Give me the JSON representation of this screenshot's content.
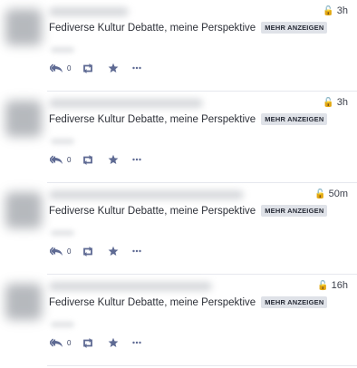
{
  "more_label": "MEHR ANZEIGEN",
  "statuses": [
    {
      "text": "Fediverse Kultur Debatte, meine Perspektive",
      "time": "3h",
      "reply_count": "0"
    },
    {
      "text": "Fediverse Kultur Debatte, meine Perspektive",
      "time": "3h",
      "reply_count": "0"
    },
    {
      "text": "Fediverse Kultur Debatte, meine Perspektive",
      "time": "50m",
      "reply_count": "0"
    },
    {
      "text": "Fediverse Kultur Debatte, meine Perspektive",
      "time": "16h",
      "reply_count": "0"
    }
  ],
  "icons": {
    "visibility": "unlock-icon",
    "reply": "reply-all-icon",
    "boost": "boost-icon",
    "favourite": "star-icon",
    "more": "ellipsis-icon"
  },
  "colors": {
    "action_icon": "#5e6a93",
    "more_button_bg": "#dfe2e8",
    "divider": "#e6e8ee"
  }
}
